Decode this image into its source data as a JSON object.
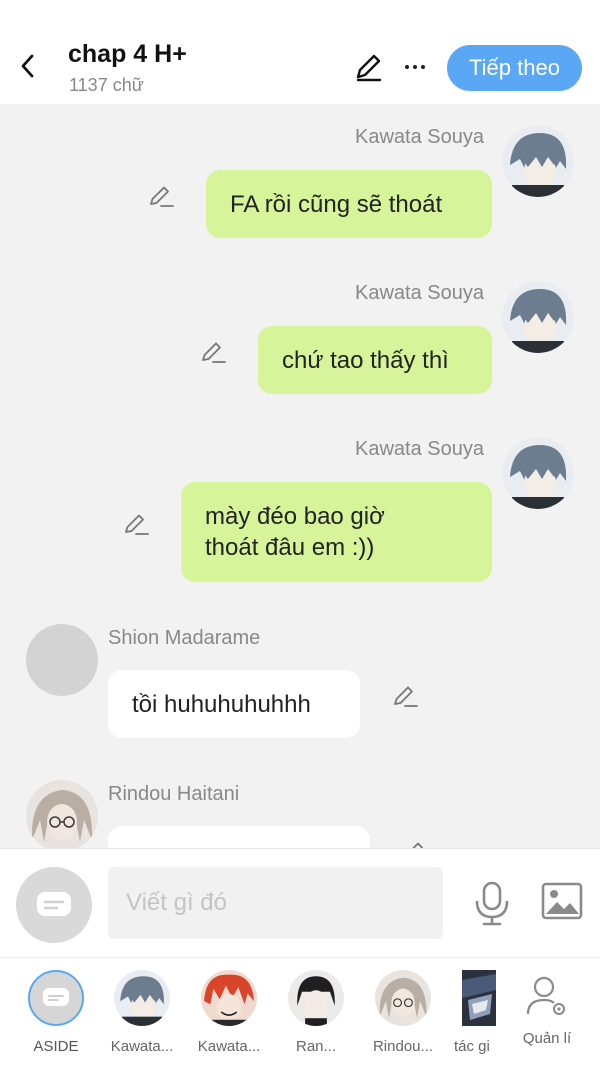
{
  "header": {
    "title": "chap 4 H+",
    "subtitle": "1137 chữ",
    "next_label": "Tiếp theo"
  },
  "messages": [
    {
      "sender": "Kawata Souya",
      "text": "FA rồi cũng sẽ thoát",
      "side": "right"
    },
    {
      "sender": "Kawata Souya",
      "text": "chứ tao thấy thì",
      "side": "right"
    },
    {
      "sender": "Kawata Souya",
      "text_line1": "mày đéo bao giờ",
      "text_line2": "thoát đâu em :))",
      "side": "right"
    },
    {
      "sender": "Shion Madarame",
      "text": "tồi huhuhuhuhhh",
      "side": "left"
    },
    {
      "sender": "Rindou Haitani",
      "text": "",
      "side": "left"
    }
  ],
  "composer": {
    "placeholder": "Viết gì đó"
  },
  "characters": [
    {
      "label": "ASIDE"
    },
    {
      "label": "Kawata..."
    },
    {
      "label": "Kawata..."
    },
    {
      "label": "Ran..."
    },
    {
      "label": "Rindou..."
    },
    {
      "label": "tác gi"
    }
  ],
  "manage_label": "Quản lí",
  "colors": {
    "accent": "#5aa8f5",
    "bubble_green": "#d6f59a",
    "bubble_white": "#ffffff",
    "background": "#f2f2f2"
  },
  "icons": [
    "back-arrow-icon",
    "pencil-icon",
    "more-dots-icon",
    "mic-icon",
    "image-icon",
    "manage-user-icon",
    "aside-chat-icon"
  ]
}
